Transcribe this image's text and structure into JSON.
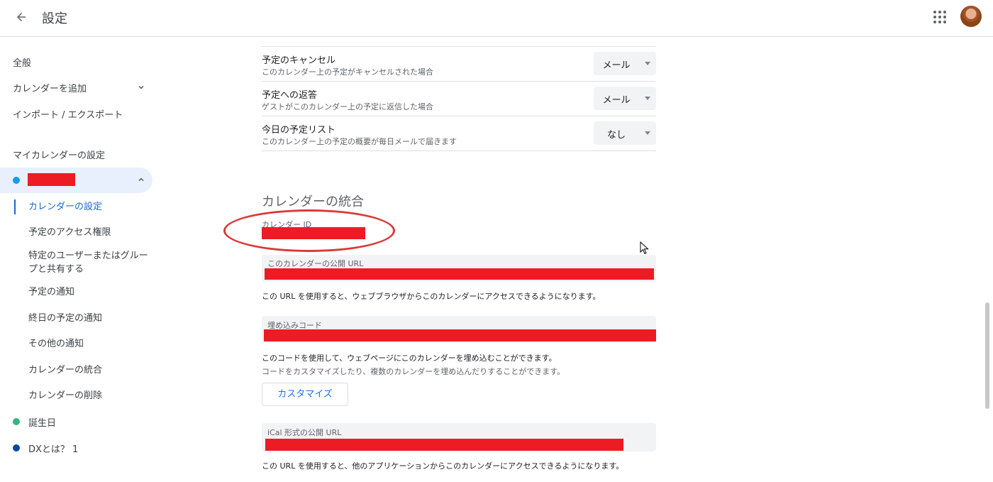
{
  "header": {
    "title": "設定"
  },
  "sidebar": {
    "general": "全般",
    "add_calendar": "カレンダーを追加",
    "import_export": "インポート / エクスポート",
    "my_calendars_label": "マイカレンダーの設定",
    "selected_calendar_color": "#1a9be6",
    "sub_items": [
      "カレンダーの設定",
      "予定のアクセス権限",
      "特定のユーザーまたはグループと共有する",
      "予定の通知",
      "終日の予定の通知",
      "その他の通知",
      "カレンダーの統合",
      "カレンダーの削除"
    ],
    "calendars": [
      {
        "name": "誕生日",
        "color": "#33b679"
      },
      {
        "name": "DXとは？ 1",
        "color": "#0b47a1"
      }
    ]
  },
  "notifications": [
    {
      "title": "予定のキャンセル",
      "desc": "このカレンダー上の予定がキャンセルされた場合",
      "value": "メール"
    },
    {
      "title": "予定への返答",
      "desc": "ゲストがこのカレンダー上の予定に返信した場合",
      "value": "メール"
    },
    {
      "title": "今日の予定リスト",
      "desc": "このカレンダー上の予定の概要が毎日メールで届きます",
      "value": "なし"
    }
  ],
  "integration": {
    "section_title": "カレンダーの統合",
    "calendar_id_label": "カレンダー ID",
    "public_url_label": "このカレンダーの公開 URL",
    "public_url_help": "この URL を使用すると、ウェブブラウザからこのカレンダーにアクセスできるようになります。",
    "embed_label": "埋め込みコード",
    "embed_help1": "このコードを使用して、ウェブページにこのカレンダーを埋め込むことができます。",
    "embed_help2": "コードをカスタマイズしたり、複数のカレンダーを埋め込んだりすることができます。",
    "customize_button": "カスタマイズ",
    "ical_label": "iCal 形式の公開 URL",
    "ical_help": "この URL を使用すると、他のアプリケーションからこのカレンダーにアクセスできるようになります。"
  },
  "colors": {
    "accent": "#1967d2",
    "redaction": "#ed1c24",
    "annotation": "#d93a3a"
  }
}
